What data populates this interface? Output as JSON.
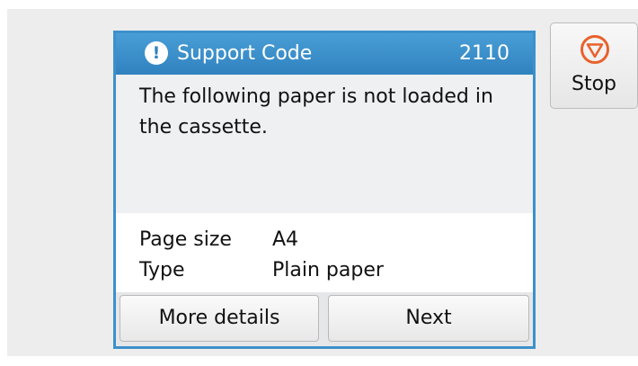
{
  "dialog": {
    "icon": "exclamation-icon",
    "title": "Support Code",
    "code": "2110",
    "message": "The following paper is not loaded in the cassette.",
    "info": [
      {
        "label": "Page size",
        "value": "A4"
      },
      {
        "label": "Type",
        "value": "Plain paper"
      }
    ],
    "buttons": {
      "more_details": "More details",
      "next": "Next"
    }
  },
  "stop": {
    "label": "Stop",
    "icon": "stop-icon"
  },
  "colors": {
    "accent": "#3d90cb",
    "stop_icon": "#e8622c"
  }
}
